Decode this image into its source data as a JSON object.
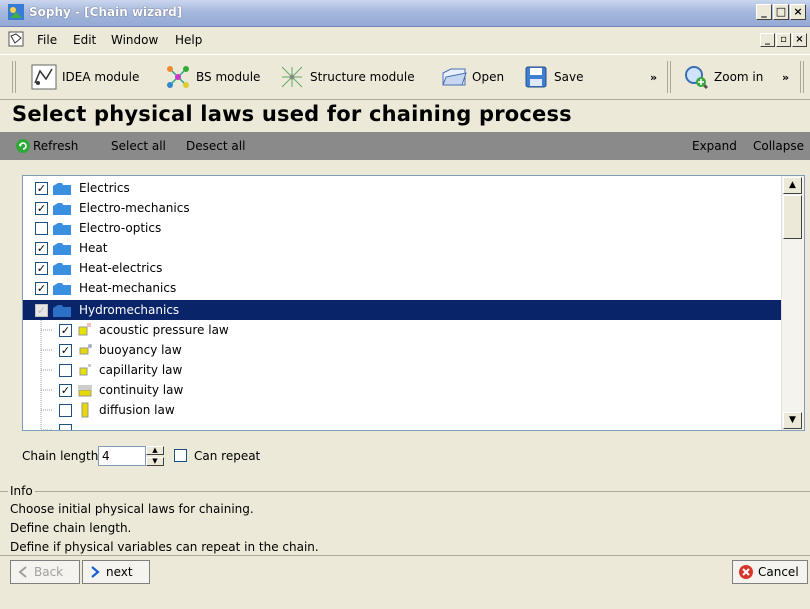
{
  "window": {
    "title": "Sophy - [Chain wizard]"
  },
  "menu": {
    "items": [
      "File",
      "Edit",
      "Window",
      "Help"
    ]
  },
  "toolbar": {
    "idea_label": "IDEA module",
    "bs_label": "BS module",
    "structure_label": "Structure module",
    "open_label": "Open",
    "save_label": "Save",
    "overflow_chevron": "»",
    "zoom_label": "Zoom in",
    "overflow_chevron_2": "»"
  },
  "heading": "Select physical laws used for chaining process",
  "actions": {
    "refresh": "Refresh",
    "select_all": "Select all",
    "deselect_all": "Desect all",
    "expand": "Expand",
    "collapse": "Collapse"
  },
  "tree": {
    "categories": [
      {
        "label": "Electrics",
        "checked": true
      },
      {
        "label": "Electro-mechanics",
        "checked": true
      },
      {
        "label": "Electro-optics",
        "checked": false
      },
      {
        "label": "Heat",
        "checked": true
      },
      {
        "label": "Heat-electrics",
        "checked": true
      },
      {
        "label": "Heat-mechanics",
        "checked": true
      },
      {
        "label": "Hydromechanics",
        "checked": true,
        "selected": true
      }
    ],
    "laws": [
      {
        "label": "acoustic pressure law",
        "checked": true
      },
      {
        "label": "buoyancy law",
        "checked": true
      },
      {
        "label": "capillarity law",
        "checked": false
      },
      {
        "label": "continuity law",
        "checked": true
      },
      {
        "label": "diffusion law",
        "checked": false
      }
    ]
  },
  "chain": {
    "length_label": "Chain length",
    "length_value": "4",
    "repeat_label": "Can repeat"
  },
  "info": {
    "title": "Info",
    "lines": [
      "Choose initial physical laws for chaining.",
      "Define chain length.",
      "Define if physical variables can repeat in the chain."
    ]
  },
  "nav": {
    "back": "Back",
    "next": "next",
    "cancel": "Cancel"
  },
  "colors": {
    "selection": "#0a246a",
    "folder": "#3b8fe0",
    "actionbar": "#8a8a8a"
  }
}
